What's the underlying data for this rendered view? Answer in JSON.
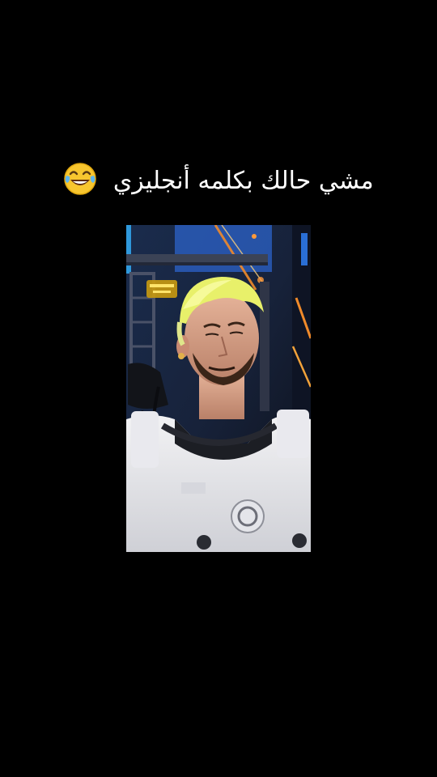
{
  "caption": {
    "text": "مشي حالك بكلمه أنجليزي",
    "emoji": "face-with-tears-of-joy-icon"
  },
  "video": {
    "subject": "man with bleached yellow hair and beard wearing white armor-style costume on a TV stage",
    "watermark_logo": "channel-logo"
  },
  "colors": {
    "background": "#000000",
    "caption_text": "#ffffff",
    "hair": "#e8f06a",
    "stage_blue": "#2a6fd6",
    "stage_orange": "#f08a2a"
  }
}
